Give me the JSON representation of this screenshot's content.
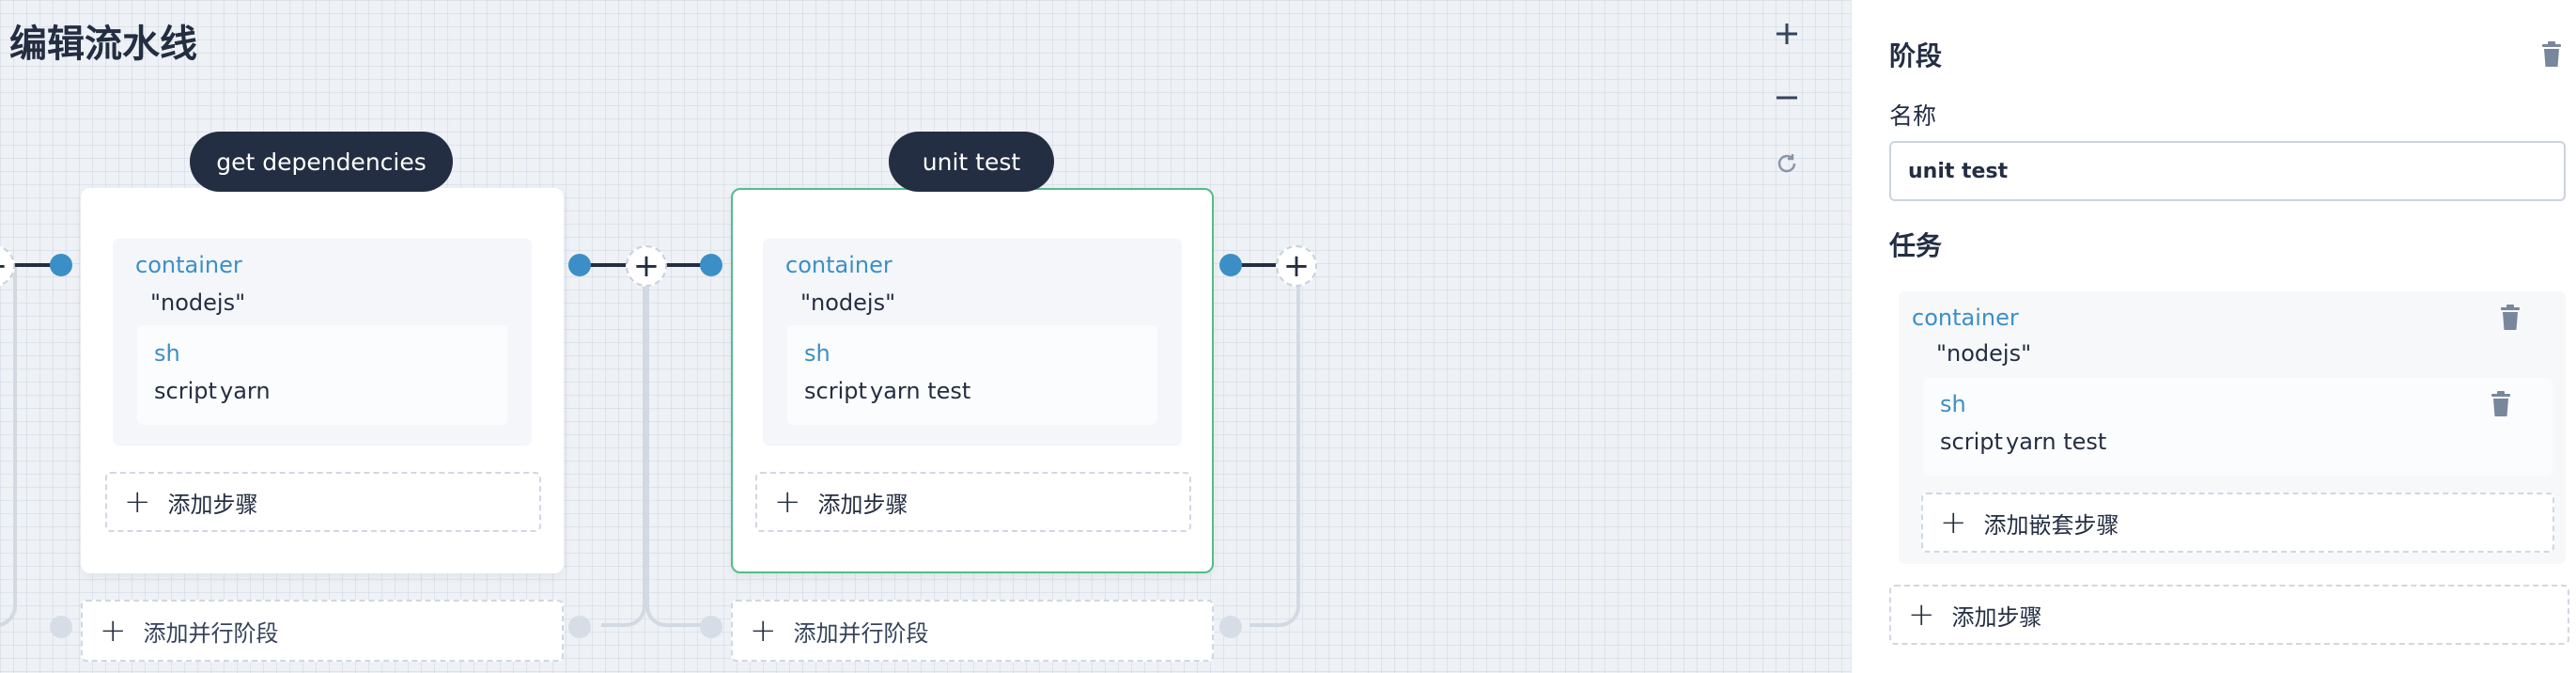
{
  "page": {
    "title": "编辑流水线",
    "zoom_in_label": "+",
    "zoom_out_label": "−",
    "reset_label": "⟳"
  },
  "stages": [
    {
      "name": "get dependencies",
      "step": {
        "title": "container",
        "arg": "\"nodejs\""
      },
      "inner_step": {
        "title": "sh",
        "arg_key": "script",
        "arg_value": "yarn"
      },
      "add_step_label": "添加步骤",
      "add_parallel_label": "添加并行阶段"
    },
    {
      "name": "unit test",
      "step": {
        "title": "container",
        "arg": "\"nodejs\""
      },
      "inner_step": {
        "title": "sh",
        "arg_key": "script",
        "arg_value": "yarn test"
      },
      "add_step_label": "添加步骤",
      "add_parallel_label": "添加并行阶段"
    }
  ],
  "connectors": {
    "plus_label": "+"
  },
  "panel": {
    "stage_heading": "阶段",
    "name_label": "名称",
    "name_value": "unit test",
    "tasks_heading": "任务",
    "task": {
      "title": "container",
      "arg": "\"nodejs\"",
      "inner": {
        "title": "sh",
        "arg_key": "script",
        "arg_value": "yarn test"
      },
      "add_nested_label": "添加嵌套步骤"
    },
    "add_step_label": "添加步骤",
    "plus_label": "+"
  },
  "colors": {
    "dark": "#242e42",
    "accent_blue": "#3c8fc6",
    "active_green": "#55bc8a"
  }
}
